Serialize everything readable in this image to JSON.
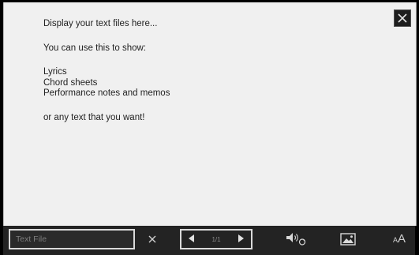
{
  "text_viewer": {
    "lines": {
      "l1": "Display your text files here...",
      "l2": "You can use this to show:",
      "l3": "Lyrics",
      "l4": "Chord sheets",
      "l5": "Performance notes and memos",
      "l6": "or any text that you want!"
    }
  },
  "toolbar": {
    "file_field_placeholder": "Text File",
    "page_indicator": "1/1",
    "font_size_small": "A",
    "font_size_large": "A"
  },
  "icons": {
    "close": "close-icon",
    "clear": "clear-icon",
    "prev": "arrow-left-icon",
    "next": "arrow-right-icon",
    "audio": "speaker-sync-icon",
    "image": "image-icon",
    "font": "font-size-icon"
  },
  "colors": {
    "screen_bg": "#f0f0f0",
    "toolbar_bg": "#232323",
    "text": "#222222"
  }
}
